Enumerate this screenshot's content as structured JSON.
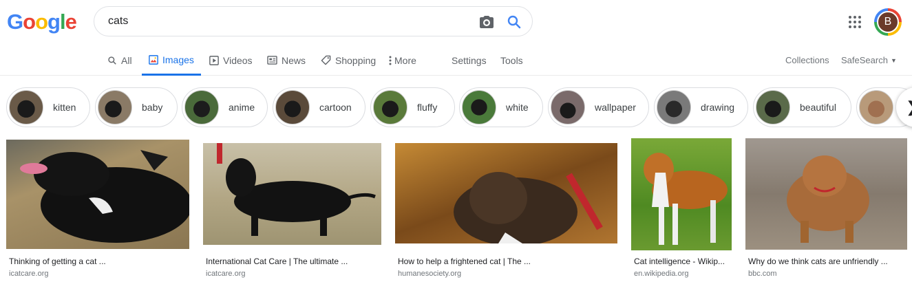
{
  "logo": {
    "letters": [
      "G",
      "o",
      "o",
      "g",
      "l",
      "e"
    ],
    "colors": [
      "#4285f4",
      "#ea4335",
      "#fbbc05",
      "#4285f4",
      "#34a853",
      "#ea4335"
    ]
  },
  "search": {
    "value": "cats"
  },
  "account": {
    "initial": "B"
  },
  "tabs": [
    {
      "label": "All",
      "icon": "search-icon"
    },
    {
      "label": "Images",
      "icon": "image-icon",
      "active": true
    },
    {
      "label": "Videos",
      "icon": "video-icon"
    },
    {
      "label": "News",
      "icon": "news-icon"
    },
    {
      "label": "Shopping",
      "icon": "tag-icon"
    },
    {
      "label": "More",
      "icon": "more-vert-icon"
    },
    {
      "label": "Settings"
    },
    {
      "label": "Tools"
    }
  ],
  "right_tabs": {
    "collections": "Collections",
    "safesearch": "SafeSearch"
  },
  "chips": [
    {
      "label": "kitten",
      "color": "#6a5a48"
    },
    {
      "label": "baby",
      "color": "#8a7a66"
    },
    {
      "label": "anime",
      "color": "#4a6a3a"
    },
    {
      "label": "cartoon",
      "color": "#5a4a3a"
    },
    {
      "label": "fluffy",
      "color": "#5a7a3a"
    },
    {
      "label": "white",
      "color": "#4a7a3a"
    },
    {
      "label": "wallpaper",
      "color": "#7a6a6a"
    },
    {
      "label": "drawing",
      "color": "#7a7a7a"
    },
    {
      "label": "beautiful",
      "color": "#5a6a4a"
    },
    {
      "label": "",
      "color": "#b89a7a"
    }
  ],
  "results": [
    {
      "title": "Thinking of getting a cat ...",
      "source": "icatcare.org",
      "bg": "#8c7a55"
    },
    {
      "title": "International Cat Care | The ultimate ...",
      "source": "icatcare.org",
      "bg": "#b8ab8a"
    },
    {
      "title": "How to help a frightened cat | The ...",
      "source": "humanesociety.org",
      "bg": "#9a6a2a"
    },
    {
      "title": "Cat intelligence - Wikip...",
      "source": "en.wikipedia.org",
      "bg": "#5a8a2a"
    },
    {
      "title": "Why do we think cats are unfriendly ...",
      "source": "bbc.com",
      "bg": "#8a8070"
    }
  ]
}
